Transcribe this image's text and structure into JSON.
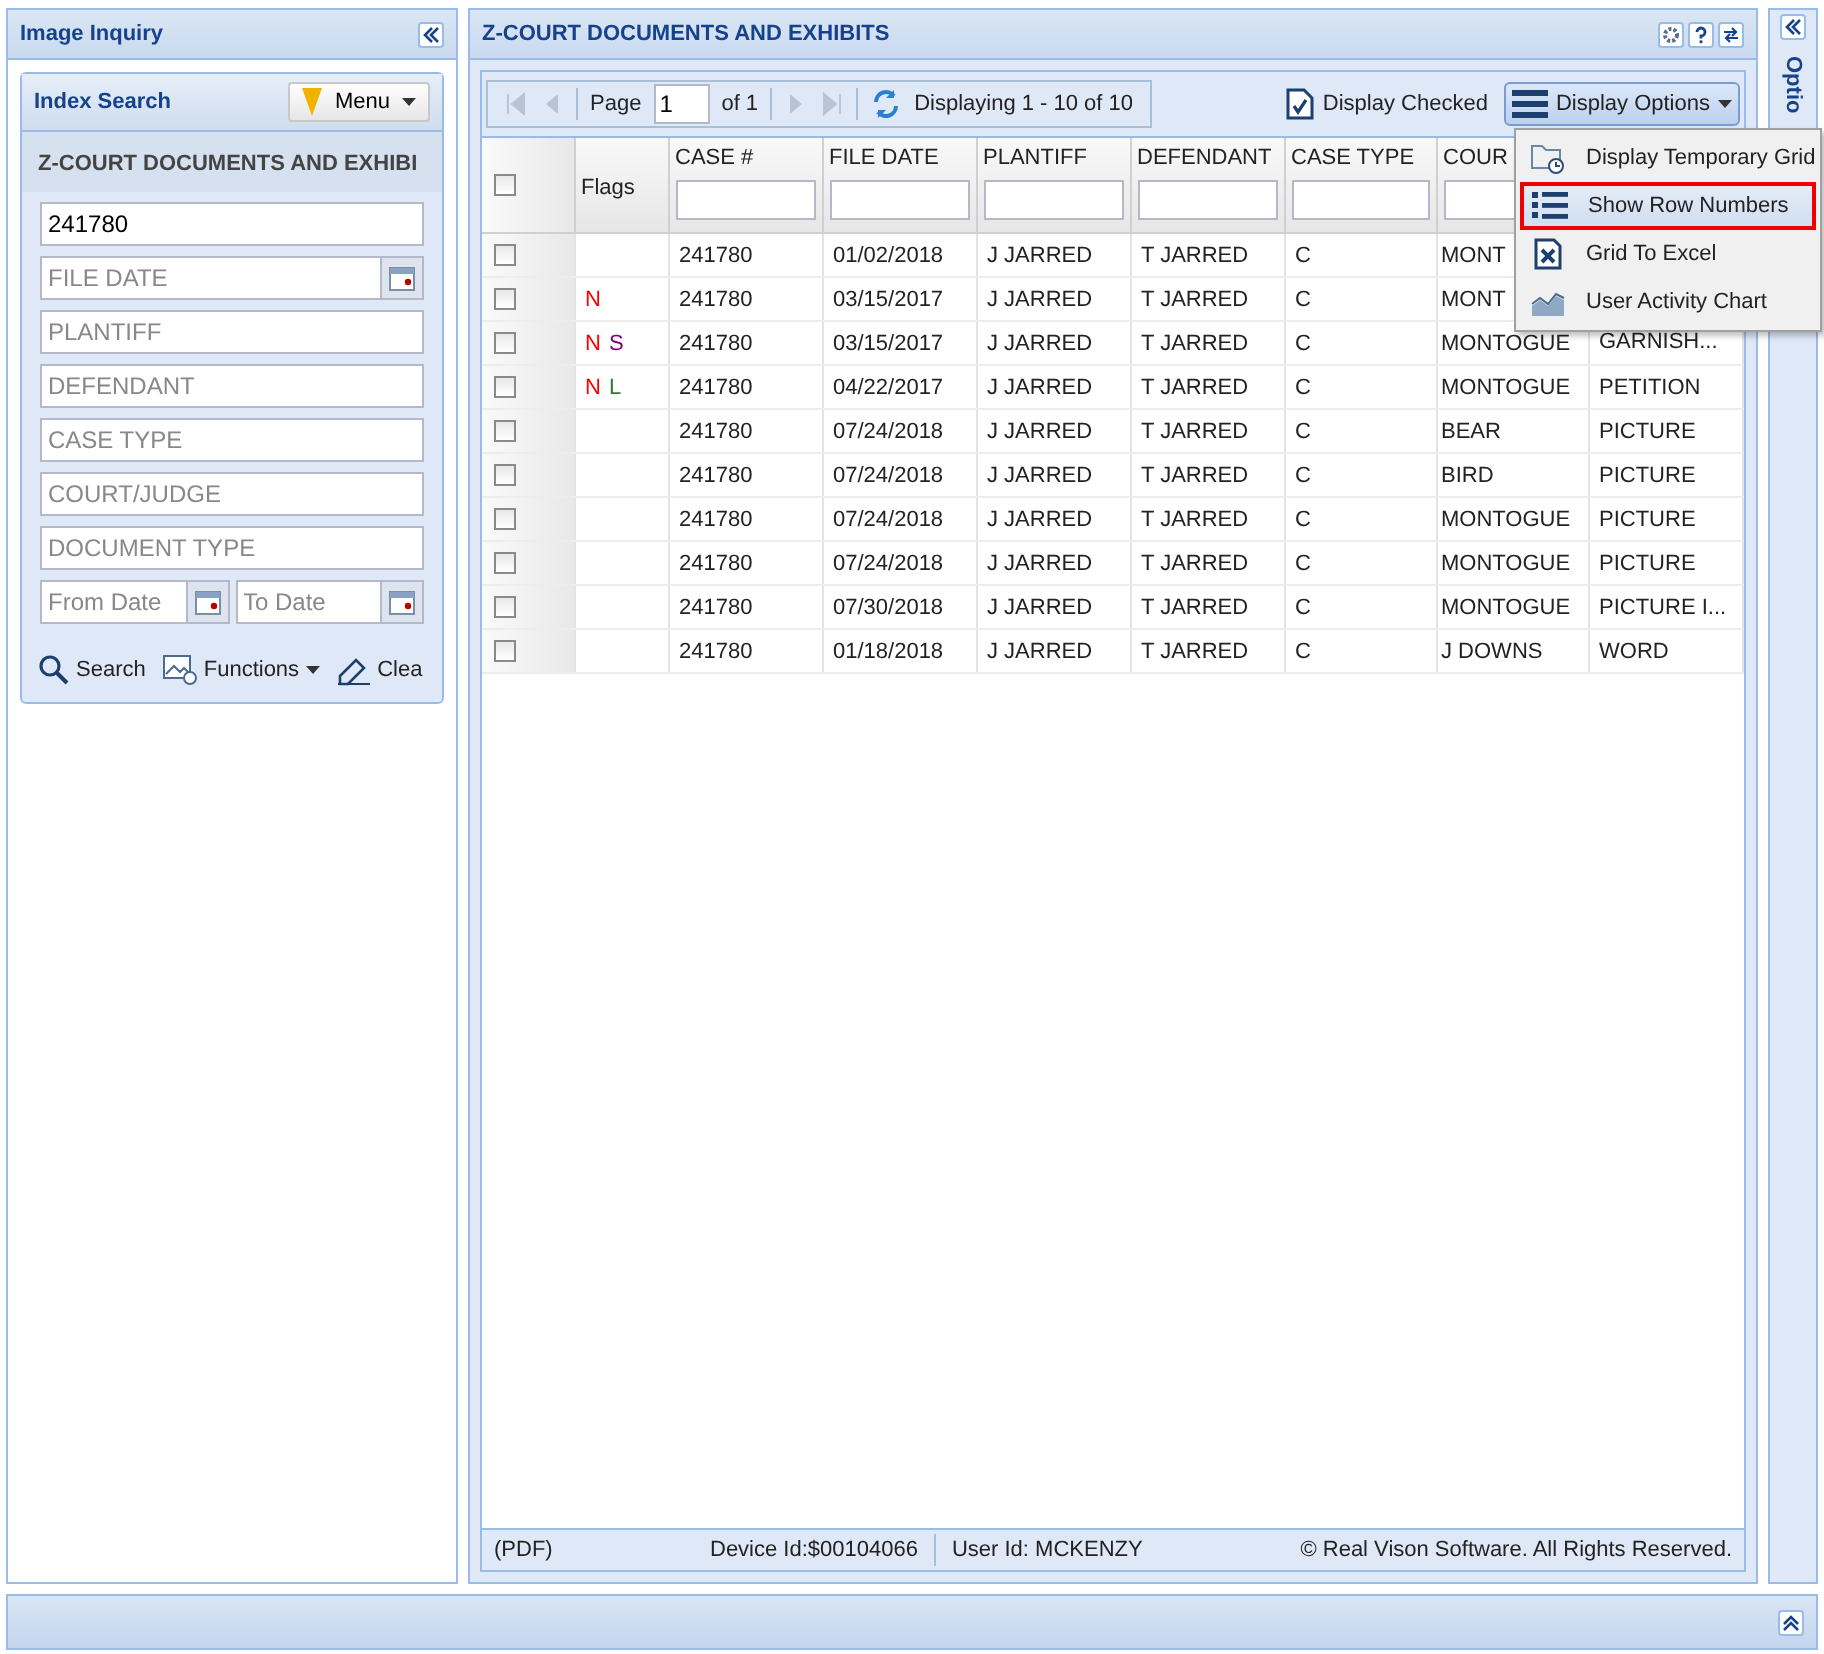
{
  "left_panel": {
    "title": "Image Inquiry",
    "search_box": {
      "title": "Index Search",
      "menu_button": "Menu",
      "form_title": "Z-COURT DOCUMENTS AND EXHIBI",
      "fields": [
        {
          "kind": "text",
          "value": "241780"
        },
        {
          "kind": "date",
          "placeholder": "FILE DATE"
        },
        {
          "kind": "text",
          "placeholder": "PLANTIFF"
        },
        {
          "kind": "text",
          "placeholder": "DEFENDANT"
        },
        {
          "kind": "text",
          "placeholder": "CASE TYPE"
        },
        {
          "kind": "text",
          "placeholder": "COURT/JUDGE"
        },
        {
          "kind": "text",
          "placeholder": "DOCUMENT TYPE"
        }
      ],
      "date_range": [
        {
          "placeholder": "From Date"
        },
        {
          "placeholder": "To Date"
        }
      ],
      "actions": [
        {
          "kind": "search",
          "label": "Search"
        },
        {
          "kind": "functions",
          "label": "Functions"
        },
        {
          "kind": "clear",
          "label": "Clea"
        }
      ]
    }
  },
  "main_panel": {
    "title": "Z-COURT DOCUMENTS AND EXHIBITS",
    "pager": {
      "page_label": "Page",
      "page": "1",
      "of": "of 1",
      "display": "Displaying 1 - 10 of 10"
    },
    "display_checked": "Display Checked",
    "display_options": "Display Options",
    "all_checked": false,
    "flags_header": "Flags",
    "columns": [
      "CASE #",
      "FILE DATE",
      "PLANTIFF",
      "DEFENDANT",
      "CASE TYPE",
      "COUR"
    ],
    "rows": [
      {
        "checked": false,
        "flags": [],
        "cells": [
          "241780",
          "01/02/2018",
          "J JARRED",
          "T JARRED",
          "C",
          "MONT"
        ]
      },
      {
        "checked": false,
        "flags": [
          {
            "text": "N",
            "color": "#ff0000"
          }
        ],
        "cells": [
          "241780",
          "03/15/2017",
          "J JARRED",
          "T JARRED",
          "C",
          "MONT"
        ]
      },
      {
        "checked": false,
        "flags": [
          {
            "text": "N",
            "color": "#ff0000"
          },
          {
            "text": "S",
            "color": "#800080"
          }
        ],
        "cells": [
          "241780",
          "03/15/2017",
          "J JARRED",
          "T JARRED",
          "C",
          "MONTOGUE",
          "GARNISH..."
        ]
      },
      {
        "checked": false,
        "flags": [
          {
            "text": "N",
            "color": "#ff0000"
          },
          {
            "text": "L",
            "color": "#2e7d32"
          }
        ],
        "cells": [
          "241780",
          "04/22/2017",
          "J JARRED",
          "T JARRED",
          "C",
          "MONTOGUE",
          "PETITION"
        ]
      },
      {
        "checked": false,
        "flags": [],
        "cells": [
          "241780",
          "07/24/2018",
          "J JARRED",
          "T JARRED",
          "C",
          "BEAR",
          "PICTURE"
        ]
      },
      {
        "checked": false,
        "flags": [],
        "cells": [
          "241780",
          "07/24/2018",
          "J JARRED",
          "T JARRED",
          "C",
          "BIRD",
          "PICTURE"
        ]
      },
      {
        "checked": false,
        "flags": [],
        "cells": [
          "241780",
          "07/24/2018",
          "J JARRED",
          "T JARRED",
          "C",
          "MONTOGUE",
          "PICTURE"
        ]
      },
      {
        "checked": false,
        "flags": [],
        "cells": [
          "241780",
          "07/24/2018",
          "J JARRED",
          "T JARRED",
          "C",
          "MONTOGUE",
          "PICTURE"
        ]
      },
      {
        "checked": false,
        "flags": [],
        "cells": [
          "241780",
          "07/30/2018",
          "J JARRED",
          "T JARRED",
          "C",
          "MONTOGUE",
          "PICTURE I..."
        ]
      },
      {
        "checked": false,
        "flags": [],
        "cells": [
          "241780",
          "01/18/2018",
          "J JARRED",
          "T JARRED",
          "C",
          "J DOWNS",
          "WORD"
        ]
      }
    ],
    "menu": [
      {
        "kind": "temp",
        "label": "Display Temporary Grid",
        "selected": false
      },
      {
        "kind": "rownum",
        "label": "Show Row Numbers",
        "selected": true
      },
      {
        "kind": "excel",
        "label": "Grid To Excel",
        "selected": false
      },
      {
        "kind": "chart",
        "label": "User Activity Chart",
        "selected": false
      }
    ],
    "status_bar": {
      "format": "(PDF)",
      "device": "Device Id:$00104066",
      "user": "User Id: MCKENZY",
      "copyright": "© Real Vison Software. All Rights Reserved."
    }
  },
  "right_panel": {
    "title": "Optio"
  }
}
